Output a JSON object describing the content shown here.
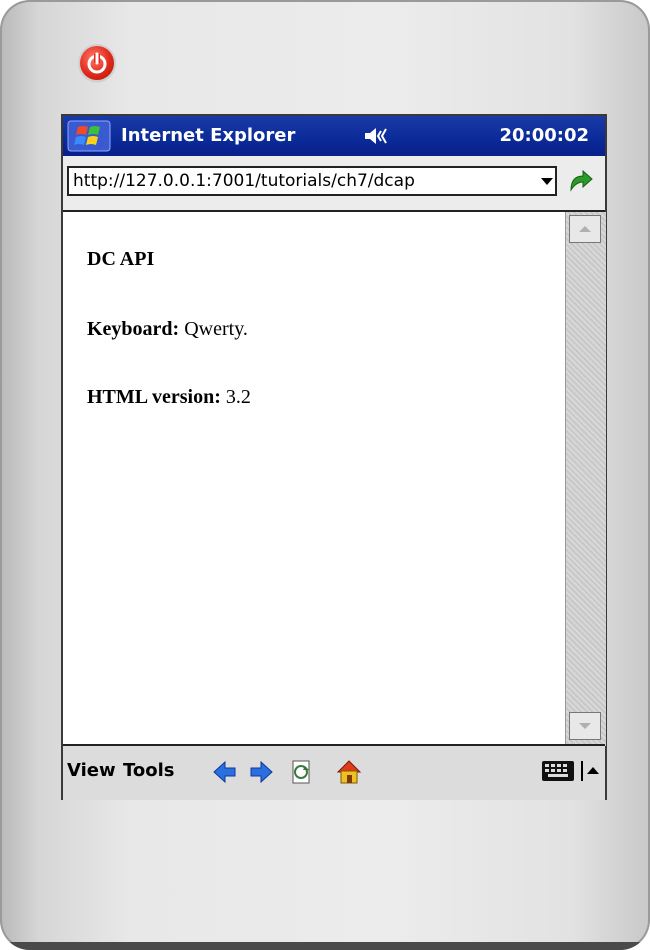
{
  "device": {
    "power_icon": "power-icon"
  },
  "titlebar": {
    "app_title": "Internet Explorer",
    "time": "20:00:02",
    "start_icon": "windows-start-icon",
    "volume_icon": "speaker-icon"
  },
  "address": {
    "url": "http://127.0.0.1:7001/tutorials/ch7/dcap",
    "dropdown_icon": "chevron-down-icon",
    "go_icon": "go-arrow-icon"
  },
  "page": {
    "heading": "DC API",
    "keyboard_label": "Keyboard:",
    "keyboard_value": "Qwerty.",
    "html_label": "HTML version:",
    "html_value": "3.2"
  },
  "menubar": {
    "view": "View",
    "tools": "Tools",
    "icons": [
      "back-icon",
      "forward-icon",
      "refresh-icon",
      "home-icon",
      "keyboard-icon",
      "up-arrow-icon"
    ]
  },
  "colors": {
    "titlebar": "#0a2a98",
    "go_arrow": "#2a9a2a",
    "nav_arrow": "#2a6ee0",
    "power": "#e02a1a"
  }
}
